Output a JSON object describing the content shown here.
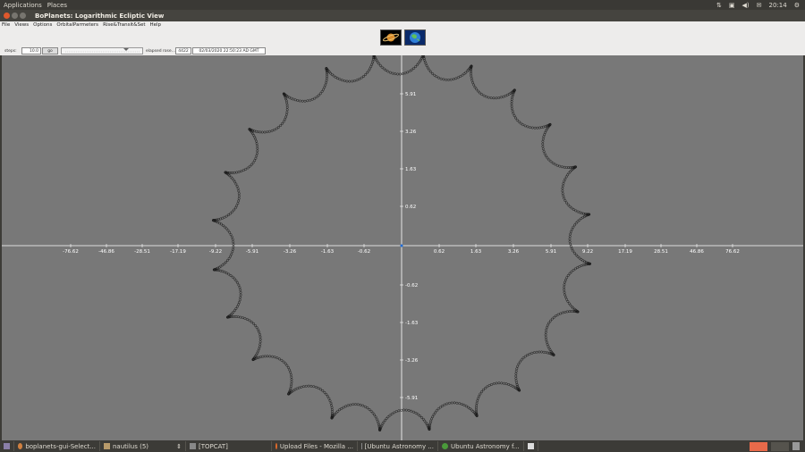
{
  "topbar": {
    "menus": [
      "Applications",
      "Places"
    ],
    "clock": "20:14"
  },
  "window": {
    "title": "BoPlanets: Logarithmic Ecliptic View"
  },
  "menubar": [
    "File",
    "Views",
    "Options",
    "OrbitalParmeters",
    "Rise&Transit&Set",
    "Help"
  ],
  "controls": {
    "steps_label": "steps:",
    "steps_value": "10.0",
    "go_button": "go",
    "elapsed_label": "elapsed rose...",
    "elapsed_value": "4422",
    "date_value": "02/03/2020 22:50:23 AD GMT"
  },
  "plot": {
    "x_ticks": [
      "-76.62",
      "-46.86",
      "-28.51",
      "-17.19",
      "-9.22",
      "-5.91",
      "-3.26",
      "-1.63",
      "-0.62",
      "0.62",
      "1.63",
      "3.26",
      "5.91",
      "9.22",
      "17.19",
      "28.51",
      "46.86",
      "76.62"
    ],
    "y_ticks": [
      "5.91",
      "3.26",
      "1.63",
      "0.62",
      "-0.62",
      "-1.63",
      "-3.26",
      "-5.91"
    ]
  },
  "taskbar": {
    "items": [
      "boplanets-gui-Select...",
      "nautilus (5)",
      "[TOPCAT]",
      "Upload Files - Mozilla ...",
      "[Ubuntu Astronomy ...",
      "Ubuntu Astronomy f..."
    ]
  },
  "colors": {
    "canvas": "#787878",
    "dots": "#1a1a1a",
    "axis": "#ffffff",
    "close": "#e0582c"
  }
}
